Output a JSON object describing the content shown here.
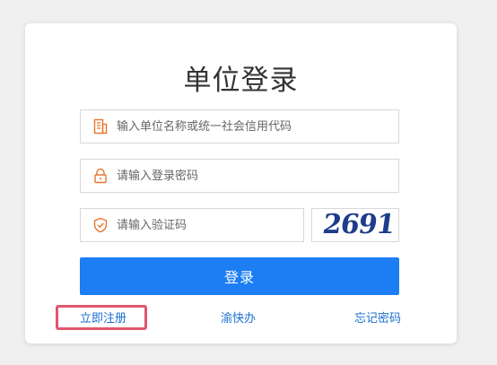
{
  "title": "单位登录",
  "fields": {
    "org_code": {
      "placeholder": "输入单位名称或统一社会信用代码",
      "value": ""
    },
    "password": {
      "placeholder": "请输入登录密码",
      "value": ""
    },
    "captcha_input": {
      "placeholder": "请输入验证码",
      "value": ""
    }
  },
  "captcha": {
    "text": "2691"
  },
  "login_button": "登录",
  "links": {
    "register": "立即注册",
    "quick": "渝快办",
    "forgot": "忘记密码"
  },
  "colors": {
    "primary": "#1c7ef2",
    "link": "#1a6fd0",
    "icon": "#e8762d",
    "highlight": "#e0566f"
  },
  "icons": {
    "org": "building-icon",
    "password": "lock-icon",
    "captcha": "shield-icon"
  }
}
